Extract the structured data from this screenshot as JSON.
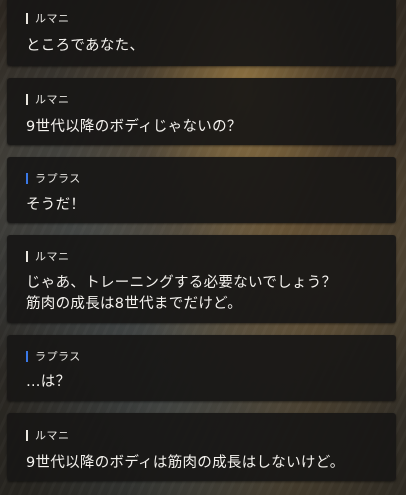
{
  "speaker_colors": {
    "ルマニ": "#e9e6df",
    "ラプラス": "#3a78e6"
  },
  "messages": [
    {
      "speaker": "ルマニ",
      "lines": [
        "ところであなた、"
      ]
    },
    {
      "speaker": "ルマニ",
      "lines": [
        "9世代以降のボディじゃないの？"
      ]
    },
    {
      "speaker": "ラプラス",
      "lines": [
        "そうだ！"
      ]
    },
    {
      "speaker": "ルマニ",
      "lines": [
        "じゃあ、トレーニングする必要ないでしょう？",
        "筋肉の成長は8世代までだけど。"
      ]
    },
    {
      "speaker": "ラプラス",
      "lines": [
        "…は？"
      ]
    },
    {
      "speaker": "ルマニ",
      "lines": [
        "9世代以降のボディは筋肉の成長はしないけど。"
      ]
    }
  ]
}
